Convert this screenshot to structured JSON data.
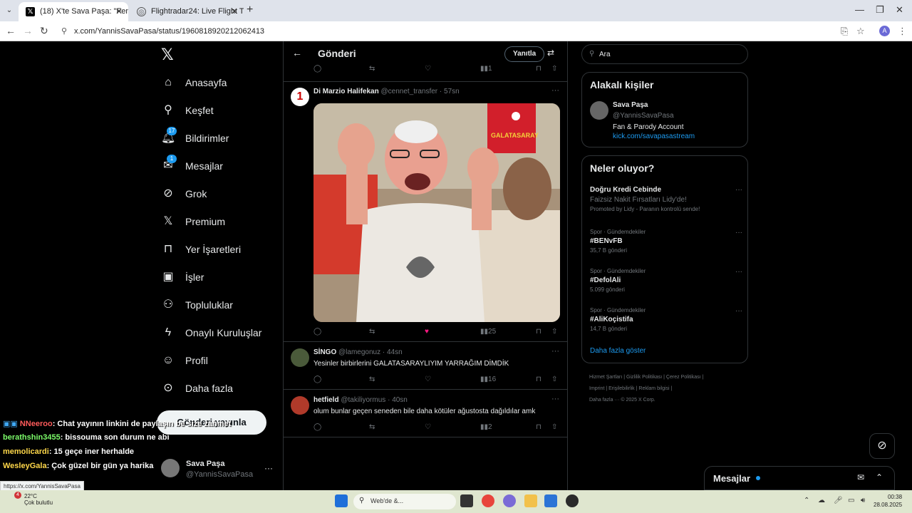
{
  "browser": {
    "tabs": [
      {
        "label": "(18) X'te Sava Paşa: \"Fenerbahçe",
        "active": true
      },
      {
        "label": "Flightradar24: Live Flight Tracke",
        "active": false
      }
    ],
    "url": "x.com/YannisSavaPasa/status/1960818920212062413",
    "status_url": "https://x.com/YannisSavaPasa",
    "profile_initial": "A"
  },
  "nav": {
    "items": [
      {
        "label": "Anasayfa",
        "icon": "home-icon"
      },
      {
        "label": "Keşfet",
        "icon": "search-icon"
      },
      {
        "label": "Bildirimler",
        "icon": "bell-icon",
        "badge": "17"
      },
      {
        "label": "Mesajlar",
        "icon": "mail-icon",
        "badge": "1"
      },
      {
        "label": "Grok",
        "icon": "grok-icon"
      },
      {
        "label": "Premium",
        "icon": "x-icon"
      },
      {
        "label": "Yer İşaretleri",
        "icon": "bookmark-icon"
      },
      {
        "label": "İşler",
        "icon": "briefcase-icon"
      },
      {
        "label": "Topluluklar",
        "icon": "people-icon"
      },
      {
        "label": "Onaylı Kuruluşlar",
        "icon": "lightning-icon"
      },
      {
        "label": "Profil",
        "icon": "person-icon"
      },
      {
        "label": "Daha fazla",
        "icon": "more-circle-icon"
      }
    ],
    "post_button": "Gönderi yayınla",
    "account": {
      "name": "Sava Paşa",
      "handle": "@YannisSavaPasa"
    }
  },
  "main": {
    "title": "Gönderi",
    "reply_button": "Yanıtla",
    "top_actions": {
      "views": "1"
    },
    "tweets": [
      {
        "name": "Di Marzio Halifekan",
        "handle": "@cennet_transfer",
        "time": "57sn",
        "text": "",
        "views": "25",
        "has_media": true
      },
      {
        "name": "SİNGO",
        "handle": "@lamegonuz",
        "time": "44sn",
        "text": "Yesinler birbirlerini GALATASARAYLIYIM YARRAĞIM DİMDİK",
        "views": "16"
      },
      {
        "name": "hetfield",
        "handle": "@takiliyormus",
        "time": "40sn",
        "text": "olum bunlar geçen seneden bile daha kötüler ağustosta dağıldılar amk",
        "views": "2"
      }
    ],
    "media_flag_text": "GALATASARAY"
  },
  "right": {
    "search_placeholder": "Ara",
    "related": {
      "title": "Alakalı kişiler",
      "name": "Sava Paşa",
      "handle": "@YannisSavaPasa",
      "bio": "Fan & Parody Account",
      "link": "kick.com/savapasastream"
    },
    "trends": {
      "title": "Neler oluyor?",
      "promo": {
        "title": "Doğru Kredi Cebinde",
        "subtitle": "Faizsiz Nakit Fırsatları Lidy'de!",
        "promoted": "Promoted by Lidy - Paranın kontrolü sende!"
      },
      "items": [
        {
          "meta": "Spor · Gündemdekiler",
          "tag": "#BENvFB",
          "count": "35,7 B gönderi"
        },
        {
          "meta": "Spor · Gündemdekiler",
          "tag": "#DefolAli",
          "count": "5.099 gönderi"
        },
        {
          "meta": "Spor · Gündemdekiler",
          "tag": "#AliKoçistifa",
          "count": "14,7 B gönderi"
        }
      ],
      "show_more": "Daha fazla göster"
    },
    "footer": [
      "Hizmet Şartları",
      "Gizlilik Politikası",
      "Çerez Politikası",
      "Imprint",
      "Erişilebilirlik",
      "Reklam bilgisi",
      "Daha fazla ···",
      "© 2025 X Corp."
    ]
  },
  "messages_drawer": {
    "title": "Mesajlar"
  },
  "chat_overlay": [
    {
      "user": "NNeeroo",
      "text": ": Chat yayının linkini de paylaşın be size zahmet",
      "color": "#ff5b5b"
    },
    {
      "user": "berathshin3455",
      "text": ": bissouma son durum ne abi",
      "color": "#7cfc6a"
    },
    {
      "user": "memolicardi",
      "text": ": 15 geçe iner herhalde",
      "color": "#ffd84a"
    },
    {
      "user": "WesleyGala",
      "text": ": Çok güzel bir gün ya harika",
      "color": "#ffd84a"
    }
  ],
  "taskbar": {
    "weather_temp": "22°C",
    "weather_text": "Çok bulutlu",
    "weather_badge": "4",
    "search_text": "Web'de &...",
    "time": "00:38",
    "date": "28.08.2025"
  },
  "colors": {
    "accent": "#1d9bf0",
    "like_active": "#f91880"
  }
}
